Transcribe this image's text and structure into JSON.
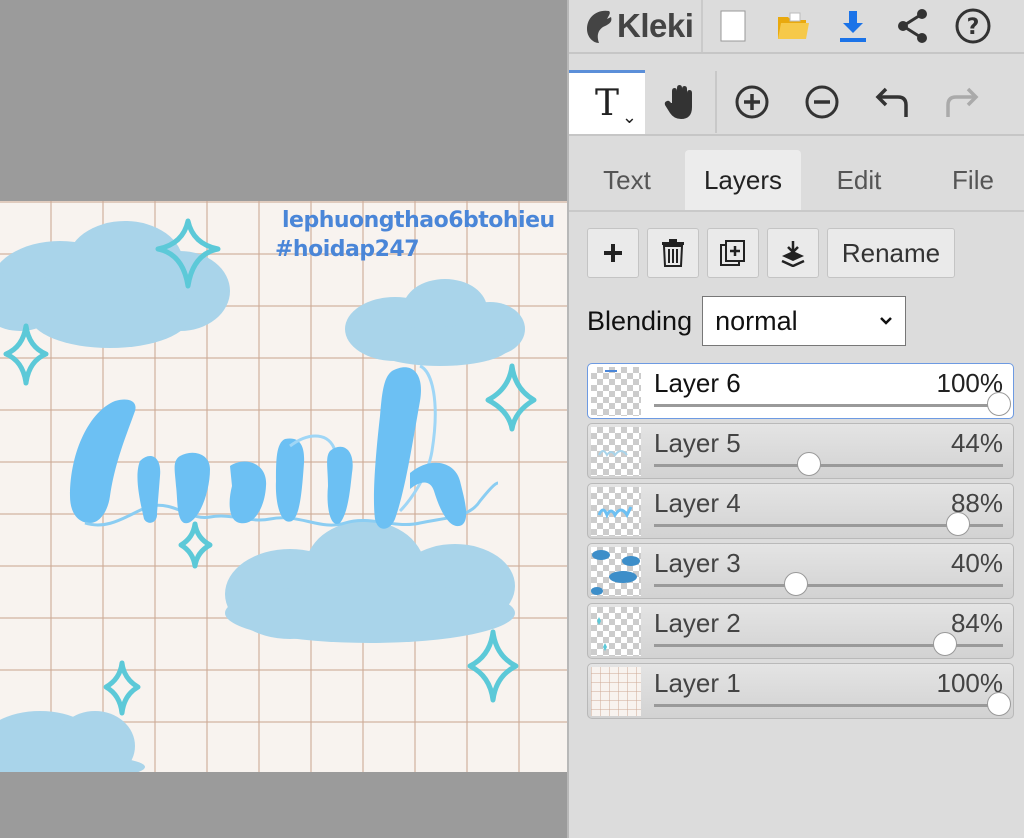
{
  "canvas": {
    "watermark_line1": "lephuongthao6btohieu",
    "watermark_line2": "#hoidap247",
    "lettering": "Linh"
  },
  "app": {
    "name": "Kleki",
    "toolbar_icons": [
      "new-file-icon",
      "open-folder-icon",
      "download-icon",
      "share-icon",
      "help-icon"
    ]
  },
  "tools": [
    {
      "name": "text-tool",
      "icon": "T"
    },
    {
      "name": "hand-tool",
      "icon": "hand"
    },
    {
      "name": "zoom-in",
      "icon": "plus-circle"
    },
    {
      "name": "zoom-out",
      "icon": "minus-circle"
    },
    {
      "name": "undo",
      "icon": "undo-arrow"
    },
    {
      "name": "redo",
      "icon": "redo-arrow"
    }
  ],
  "tabs": [
    {
      "label": "Text",
      "active": false
    },
    {
      "label": "Layers",
      "active": true
    },
    {
      "label": "Edit",
      "active": false
    },
    {
      "label": "File",
      "active": false
    }
  ],
  "layer_actions": {
    "rename_label": "Rename",
    "icons": [
      "add-layer-icon",
      "delete-layer-icon",
      "duplicate-layer-icon",
      "merge-down-icon"
    ]
  },
  "blending": {
    "label": "Blending",
    "value": "normal"
  },
  "layers": [
    {
      "name": "Layer 6",
      "opacity": "100%",
      "value": 100,
      "active": true
    },
    {
      "name": "Layer 5",
      "opacity": "44%",
      "value": 44,
      "active": false
    },
    {
      "name": "Layer 4",
      "opacity": "88%",
      "value": 88,
      "active": false
    },
    {
      "name": "Layer 3",
      "opacity": "40%",
      "value": 40,
      "active": false
    },
    {
      "name": "Layer 2",
      "opacity": "84%",
      "value": 84,
      "active": false
    },
    {
      "name": "Layer 1",
      "opacity": "100%",
      "value": 100,
      "active": false
    }
  ],
  "colors": {
    "accent": "#5b8fd9",
    "cloud": "#a9d4ea",
    "lettering": "#6cc0f3",
    "sparkle": "#5cc9d8",
    "watermark": "#4a86d8"
  }
}
